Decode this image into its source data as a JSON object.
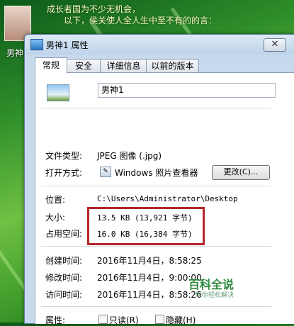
{
  "desktop": {
    "icon_label": "男神",
    "banner_lines": [
      "成长者国为不少无机会，",
      "以下，侯关使人全人生中至不有的的言："
    ]
  },
  "window": {
    "title": "男神1 属性",
    "close_glyph": "✕",
    "tabs": [
      {
        "label": "常规",
        "active": true
      },
      {
        "label": "安全",
        "active": false
      },
      {
        "label": "详细信息",
        "active": false
      },
      {
        "label": "以前的版本",
        "active": false
      }
    ]
  },
  "general": {
    "file_name": "男神1",
    "file_type": {
      "label": "文件类型:",
      "value": "JPEG 图像 (.jpg)"
    },
    "opens_with": {
      "label": "打开方式:",
      "value": "Windows 照片查看器",
      "change_button": "更改(C)..."
    },
    "location": {
      "label": "位置:",
      "value": "C:\\Users\\Administrator\\Desktop"
    },
    "size": {
      "label": "大小:",
      "value": "13.5 KB (13,921 字节)"
    },
    "size_on_disk": {
      "label": "占用空间:",
      "value": "16.0 KB (16,384 字节)"
    },
    "created": {
      "label": "创建时间:",
      "value": "2016年11月4日，8:58:25"
    },
    "modified": {
      "label": "修改时间:",
      "value": "2016年11月4日，9:00:00"
    },
    "accessed": {
      "label": "访问时间:",
      "value": "2016年11月4日，8:58:26"
    },
    "attributes": {
      "label": "属性:",
      "readonly": "只读(R)",
      "hidden": "隐藏(H)"
    }
  },
  "watermark": {
    "title": "百科全说",
    "subtitle": "助你轻松解决"
  },
  "colors": {
    "highlight": "#b3262a",
    "window_frame": "#c7d9ed"
  }
}
